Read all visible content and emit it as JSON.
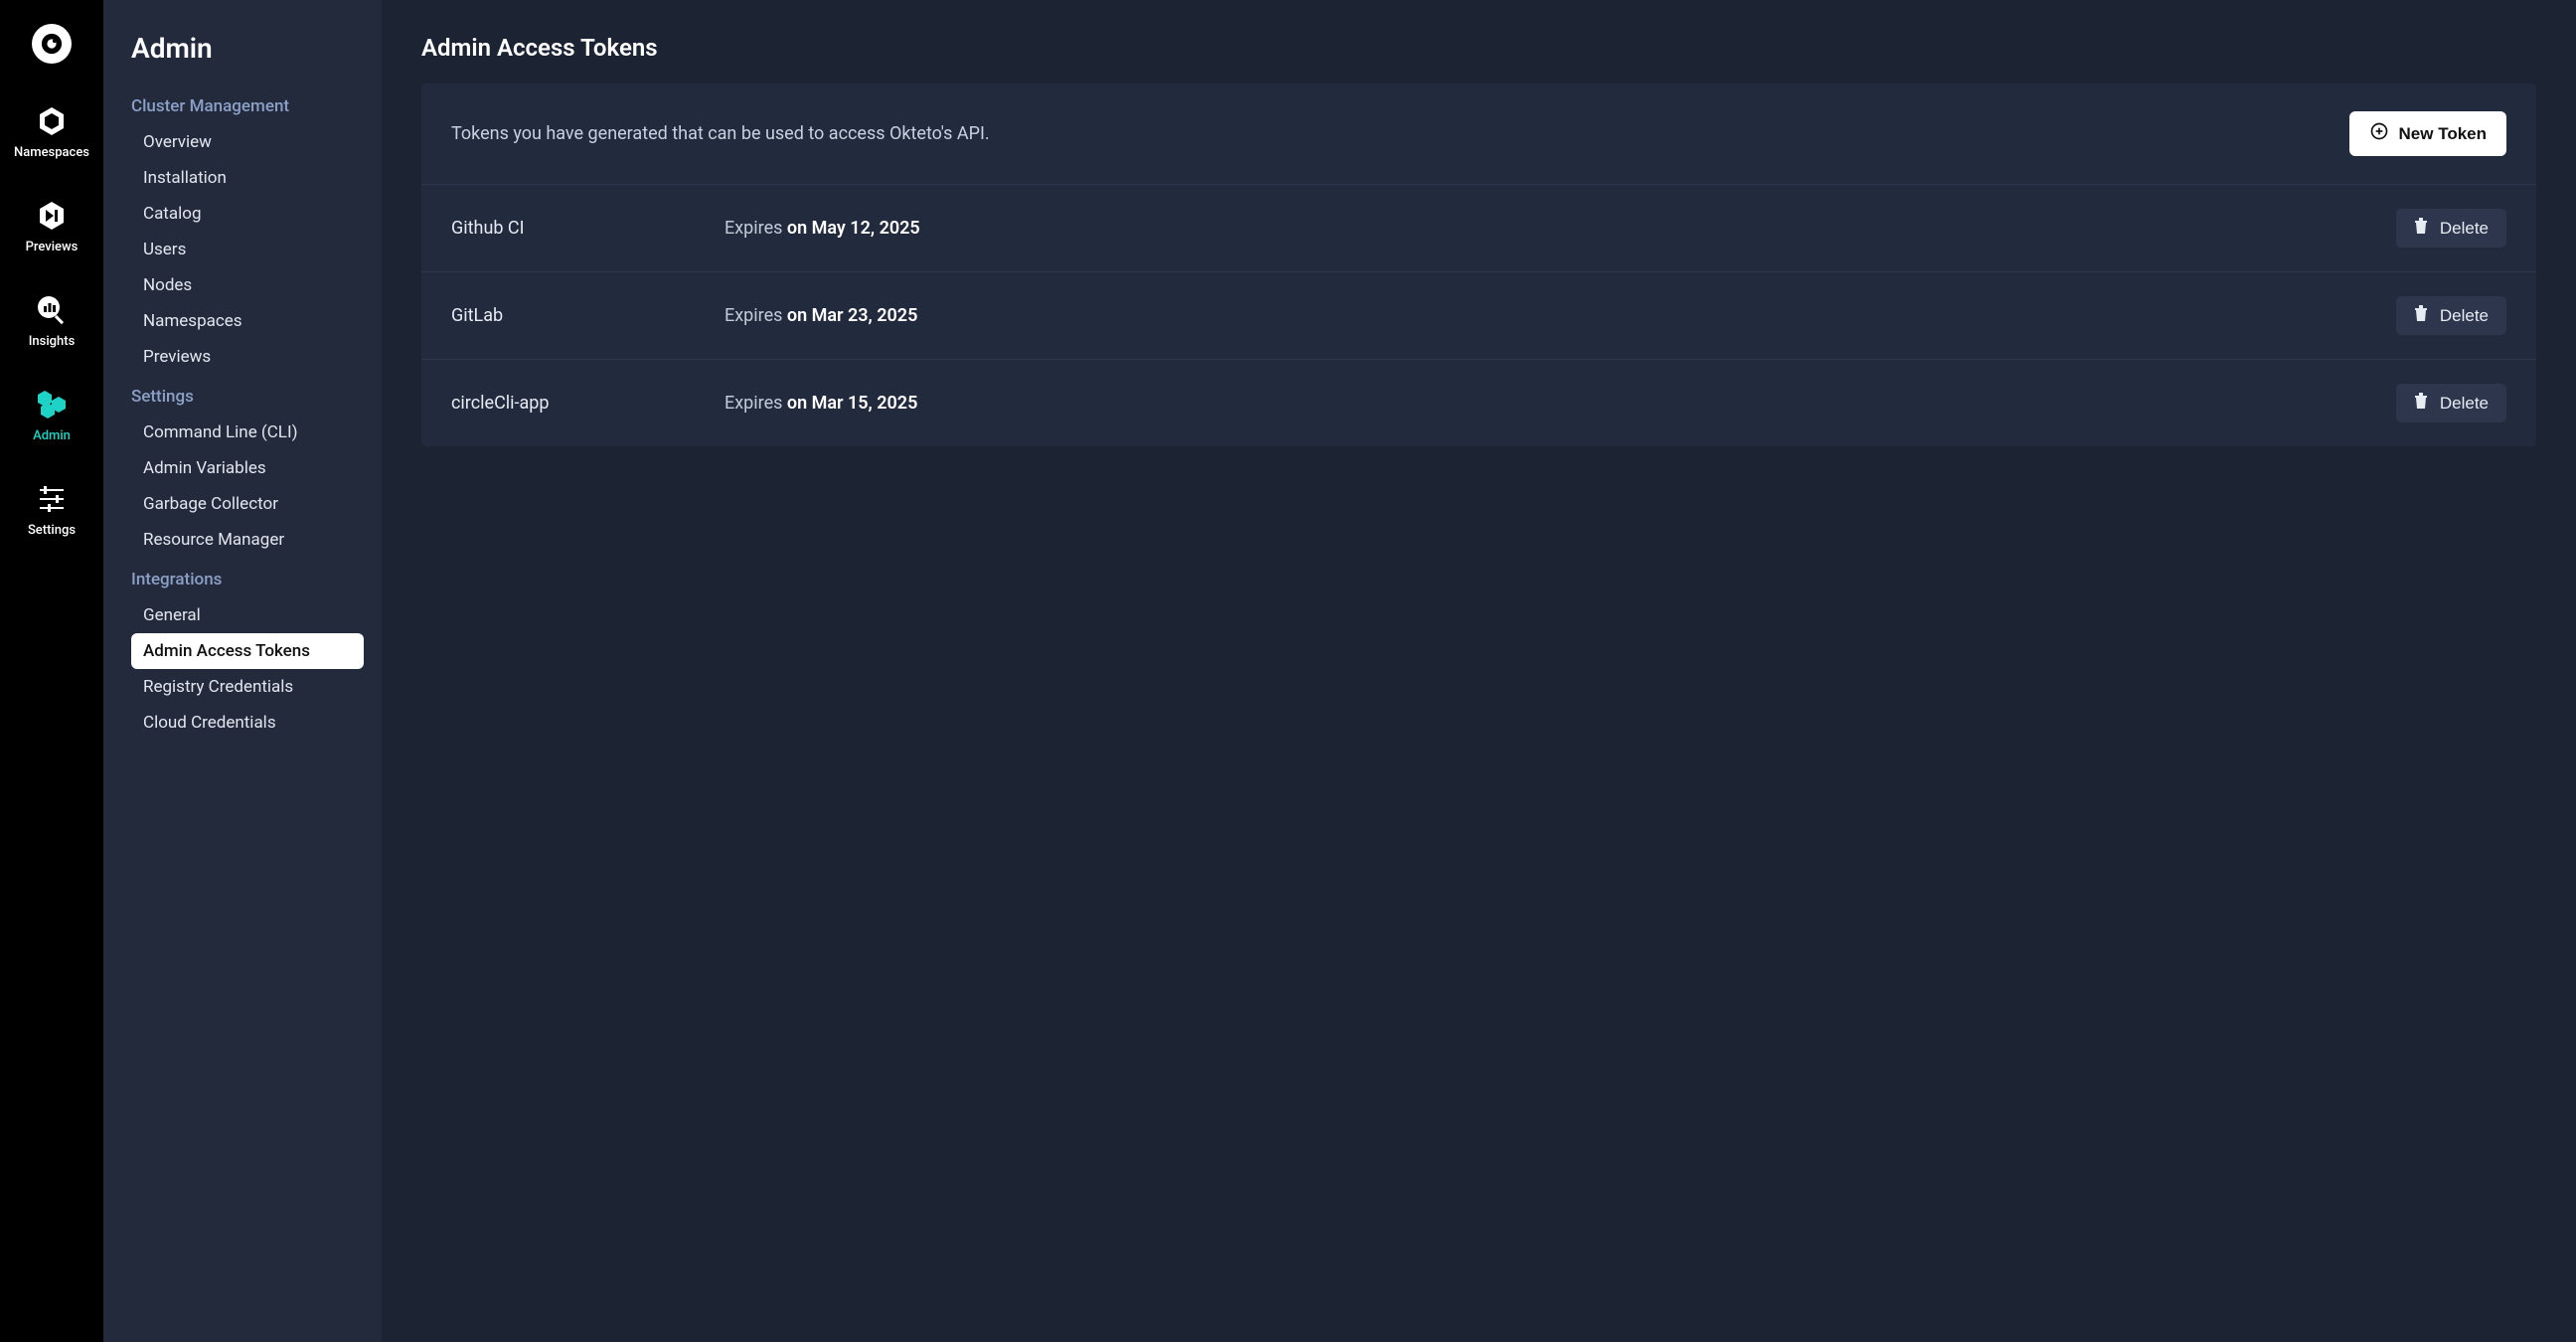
{
  "rail": {
    "items": [
      {
        "label": "Namespaces"
      },
      {
        "label": "Previews"
      },
      {
        "label": "Insights"
      },
      {
        "label": "Admin"
      },
      {
        "label": "Settings"
      }
    ]
  },
  "sidebar": {
    "title": "Admin",
    "sections": [
      {
        "header": "Cluster Management",
        "items": [
          "Overview",
          "Installation",
          "Catalog",
          "Users",
          "Nodes",
          "Namespaces",
          "Previews"
        ]
      },
      {
        "header": "Settings",
        "items": [
          "Command Line (CLI)",
          "Admin Variables",
          "Garbage Collector",
          "Resource Manager"
        ]
      },
      {
        "header": "Integrations",
        "items": [
          "General",
          "Admin Access Tokens",
          "Registry Credentials",
          "Cloud Credentials"
        ]
      }
    ],
    "active": "Admin Access Tokens"
  },
  "main": {
    "title": "Admin Access Tokens",
    "description": "Tokens you have generated that can be used to access Okteto's API.",
    "newTokenLabel": "New Token",
    "expiresPrefix": "Expires ",
    "deleteLabel": "Delete",
    "tokens": [
      {
        "name": "Github CI",
        "date": "on May 12, 2025"
      },
      {
        "name": "GitLab",
        "date": "on Mar 23, 2025"
      },
      {
        "name": "circleCli-app",
        "date": "on Mar 15, 2025"
      }
    ]
  }
}
